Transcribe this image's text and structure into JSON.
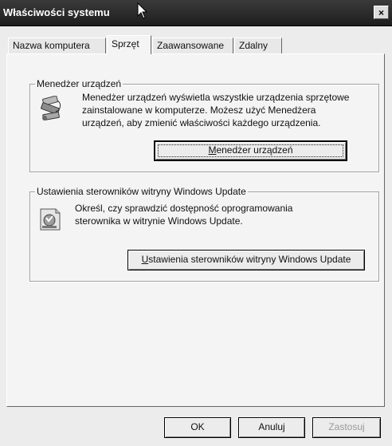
{
  "window": {
    "title": "Właściwości systemu",
    "close_label": "×"
  },
  "tabs": [
    {
      "label": "Nazwa komputera",
      "active": false
    },
    {
      "label": "Sprzęt",
      "active": true
    },
    {
      "label": "Zaawansowane",
      "active": false
    },
    {
      "label": "Zdalny",
      "active": false
    }
  ],
  "device_manager": {
    "legend": "Menedżer urządzeń",
    "description_lines": [
      "Menedżer urządzeń wyświetla wszystkie urządzenia sprzętowe",
      "zainstalowane w komputerze. Możesz użyć Menedżera",
      "urządzeń, aby zmienić właściwości każdego urządzenia."
    ],
    "button_accel": "M",
    "button_rest": "enedżer urządzeń"
  },
  "windows_update": {
    "legend": "Ustawienia sterowników witryny Windows Update",
    "description_lines": [
      "Określ, czy sprawdzić dostępność oprogramowania",
      "sterownika w witrynie Windows Update."
    ],
    "button_accel": "U",
    "button_rest": "stawienia sterowników witryny Windows Update"
  },
  "footer": {
    "ok": "OK",
    "cancel": "Anuluj",
    "apply": "Zastosuj"
  }
}
